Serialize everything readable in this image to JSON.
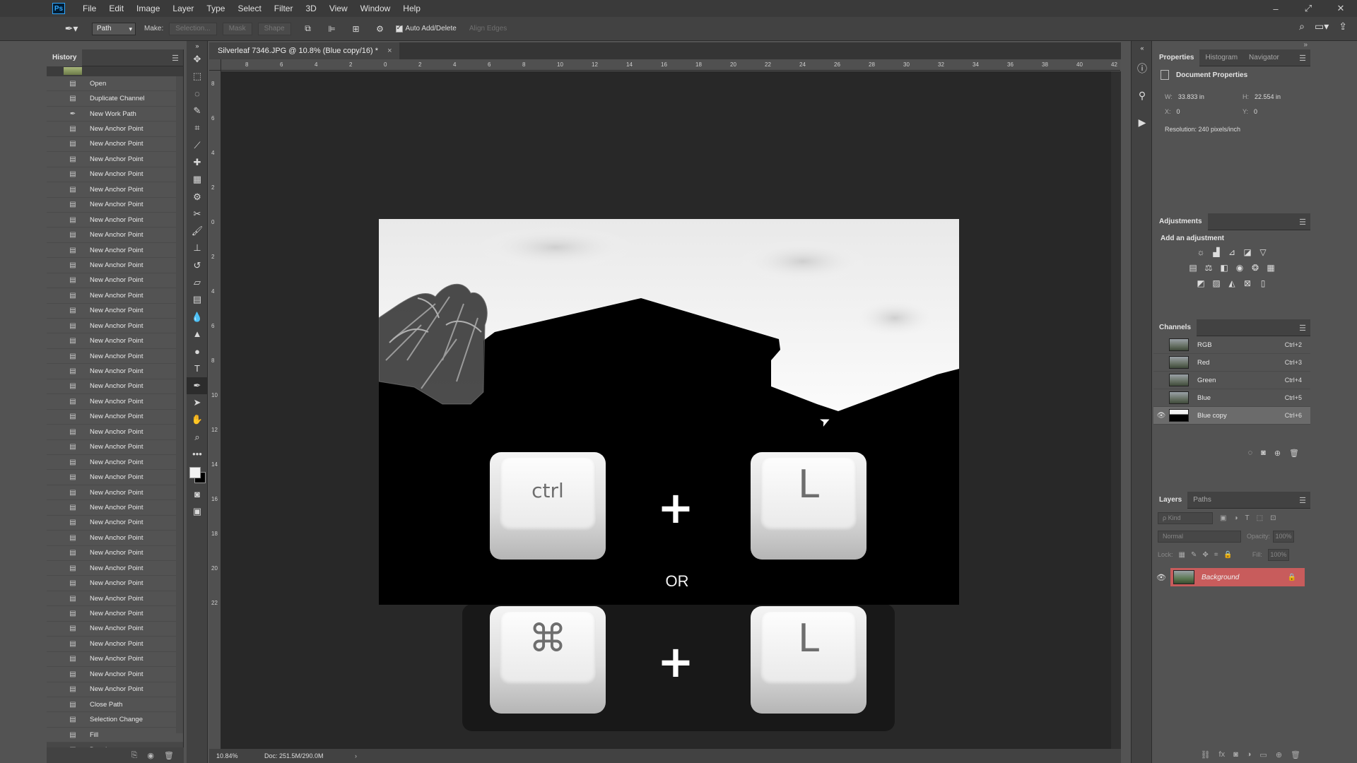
{
  "app": {
    "logo": "Ps",
    "menu": [
      "File",
      "Edit",
      "Image",
      "Layer",
      "Type",
      "Select",
      "Filter",
      "3D",
      "View",
      "Window",
      "Help"
    ]
  },
  "options": {
    "mode_value": "Path",
    "make_label": "Make:",
    "selection_btn": "Selection...",
    "mask_btn": "Mask",
    "shape_btn": "Shape",
    "auto_add_label": "Auto Add/Delete",
    "align_edges_label": "Align Edges"
  },
  "history": {
    "tab": "History",
    "items": [
      {
        "icon": "doc",
        "label": "Open"
      },
      {
        "icon": "doc",
        "label": "Duplicate Channel"
      },
      {
        "icon": "pen",
        "label": "New Work Path"
      },
      {
        "icon": "doc",
        "label": "New Anchor Point"
      },
      {
        "icon": "doc",
        "label": "New Anchor Point"
      },
      {
        "icon": "doc",
        "label": "New Anchor Point"
      },
      {
        "icon": "doc",
        "label": "New Anchor Point"
      },
      {
        "icon": "doc",
        "label": "New Anchor Point"
      },
      {
        "icon": "doc",
        "label": "New Anchor Point"
      },
      {
        "icon": "doc",
        "label": "New Anchor Point"
      },
      {
        "icon": "doc",
        "label": "New Anchor Point"
      },
      {
        "icon": "doc",
        "label": "New Anchor Point"
      },
      {
        "icon": "doc",
        "label": "New Anchor Point"
      },
      {
        "icon": "doc",
        "label": "New Anchor Point"
      },
      {
        "icon": "doc",
        "label": "New Anchor Point"
      },
      {
        "icon": "doc",
        "label": "New Anchor Point"
      },
      {
        "icon": "doc",
        "label": "New Anchor Point"
      },
      {
        "icon": "doc",
        "label": "New Anchor Point"
      },
      {
        "icon": "doc",
        "label": "New Anchor Point"
      },
      {
        "icon": "doc",
        "label": "New Anchor Point"
      },
      {
        "icon": "doc",
        "label": "New Anchor Point"
      },
      {
        "icon": "doc",
        "label": "New Anchor Point"
      },
      {
        "icon": "doc",
        "label": "New Anchor Point"
      },
      {
        "icon": "doc",
        "label": "New Anchor Point"
      },
      {
        "icon": "doc",
        "label": "New Anchor Point"
      },
      {
        "icon": "doc",
        "label": "New Anchor Point"
      },
      {
        "icon": "doc",
        "label": "New Anchor Point"
      },
      {
        "icon": "doc",
        "label": "New Anchor Point"
      },
      {
        "icon": "doc",
        "label": "New Anchor Point"
      },
      {
        "icon": "doc",
        "label": "New Anchor Point"
      },
      {
        "icon": "doc",
        "label": "New Anchor Point"
      },
      {
        "icon": "doc",
        "label": "New Anchor Point"
      },
      {
        "icon": "doc",
        "label": "New Anchor Point"
      },
      {
        "icon": "doc",
        "label": "New Anchor Point"
      },
      {
        "icon": "doc",
        "label": "New Anchor Point"
      },
      {
        "icon": "doc",
        "label": "New Anchor Point"
      },
      {
        "icon": "doc",
        "label": "New Anchor Point"
      },
      {
        "icon": "doc",
        "label": "New Anchor Point"
      },
      {
        "icon": "doc",
        "label": "New Anchor Point"
      },
      {
        "icon": "doc",
        "label": "New Anchor Point"
      },
      {
        "icon": "doc",
        "label": "New Anchor Point"
      },
      {
        "icon": "doc",
        "label": "Close Path"
      },
      {
        "icon": "doc",
        "label": "Selection Change"
      },
      {
        "icon": "doc",
        "label": "Fill"
      },
      {
        "icon": "doc",
        "label": "Deselect"
      }
    ]
  },
  "document": {
    "tab_title": "Silverleaf 7346.JPG @ 10.8% (Blue copy/16) *",
    "close": "×",
    "ruler_top": [
      "8",
      "6",
      "4",
      "2",
      "0",
      "2",
      "4",
      "6",
      "8",
      "10",
      "12",
      "14",
      "16",
      "18",
      "20",
      "22",
      "24",
      "26",
      "28",
      "30",
      "32",
      "34",
      "36",
      "38",
      "40",
      "42"
    ],
    "ruler_left": [
      "8",
      "6",
      "4",
      "2",
      "0",
      "2",
      "4",
      "6",
      "8",
      "10",
      "12",
      "14",
      "16",
      "18",
      "20",
      "22"
    ],
    "zoom": "10.84%",
    "doc_size": "Doc: 251.5M/290.0M",
    "status_arrow": "›"
  },
  "canvas": {
    "key1_top": "ctrl",
    "key2_top": "L",
    "or_text": "OR",
    "key1_bottom": "⌘",
    "key2_bottom": "L",
    "plus": "+"
  },
  "properties": {
    "tabs": [
      "Properties",
      "Histogram",
      "Navigator"
    ],
    "title": "Document Properties",
    "w_label": "W:",
    "w_value": "33.833 in",
    "h_label": "H:",
    "h_value": "22.554 in",
    "x_label": "X:",
    "x_value": "0",
    "y_label": "Y:",
    "y_value": "0",
    "resolution": "Resolution: 240 pixels/inch"
  },
  "adjustments": {
    "tab": "Adjustments",
    "title": "Add an adjustment"
  },
  "channels": {
    "tab": "Channels",
    "items": [
      {
        "name": "RGB",
        "shortcut": "Ctrl+2",
        "visible": false
      },
      {
        "name": "Red",
        "shortcut": "Ctrl+3",
        "visible": false
      },
      {
        "name": "Green",
        "shortcut": "Ctrl+4",
        "visible": false
      },
      {
        "name": "Blue",
        "shortcut": "Ctrl+5",
        "visible": false
      },
      {
        "name": "Blue copy",
        "shortcut": "Ctrl+6",
        "visible": true
      }
    ]
  },
  "layers": {
    "tabs": [
      "Layers",
      "Paths"
    ],
    "kind_placeholder": "ρ Kind",
    "blend_mode": "Normal",
    "opacity_label": "Opacity:",
    "opacity_value": "100%",
    "lock_label": "Lock:",
    "fill_label": "Fill:",
    "fill_value": "100%",
    "layer_name": "Background"
  },
  "colors": {
    "accent_layer": "#c85c5c",
    "fg": "#f2f2f2",
    "bg": "#000000"
  }
}
